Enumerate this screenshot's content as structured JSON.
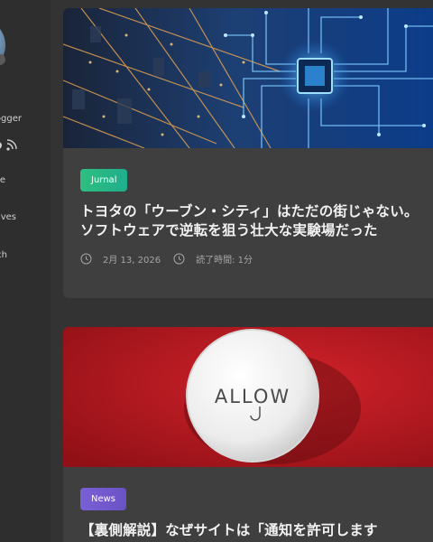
{
  "sidebar": {
    "blogger_text": "Blogger",
    "items": [
      {
        "label": "Home"
      },
      {
        "label": "Archives"
      },
      {
        "label": "Search"
      }
    ]
  },
  "posts": [
    {
      "category": "Jurnal",
      "title": "トヨタの「ウーブン・シティ」はただの街じゃない。ソフトウェアで逆転を狙う壮大な実験場だった",
      "date": "2月 13, 2026",
      "read_time": "読了時間: 1分",
      "image": "city-circuit-board"
    },
    {
      "category": "News",
      "title": "【裏側解説】なぜサイトは「通知を許可します",
      "image": "allow-button",
      "image_text": "ALLOW"
    }
  ],
  "colors": {
    "background": "#333333",
    "card": "#3f3f3f",
    "badge_jurnal": "#24b886",
    "badge_news": "#7058cc"
  }
}
